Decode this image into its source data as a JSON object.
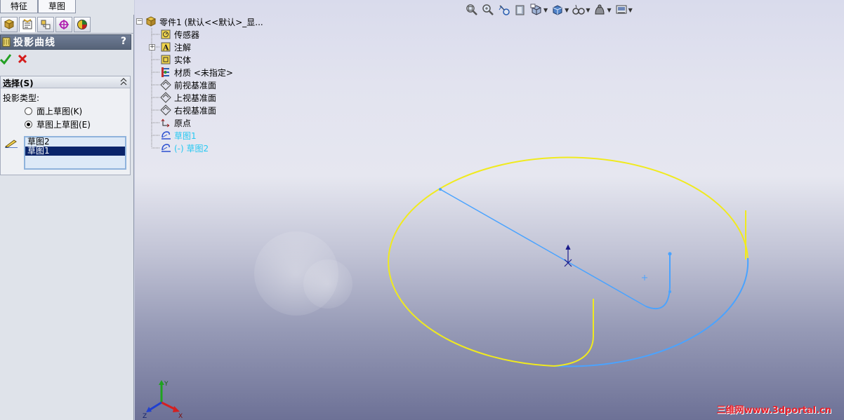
{
  "tabs": {
    "features": "特征",
    "sketch": "草图"
  },
  "property_manager": {
    "title": "投影曲线",
    "help": "?",
    "ok_icon": "check-icon",
    "cancel_icon": "x-icon",
    "selection_group": {
      "title": "选择(S)",
      "projection_type_label": "投影类型:",
      "options": [
        {
          "label": "面上草图(K)",
          "checked": false
        },
        {
          "label": "草图上草图(E)",
          "checked": true
        }
      ],
      "selected_items": [
        {
          "label": "草图2",
          "selected": false
        },
        {
          "label": "草图1",
          "selected": true
        }
      ]
    }
  },
  "feature_tree": {
    "root": "零件1   (默认<<默认>_显...",
    "items": [
      {
        "label": "传感器",
        "icon": "sensor-icon"
      },
      {
        "label": "注解",
        "icon": "annotation-icon"
      },
      {
        "label": "实体",
        "icon": "solid-body-icon"
      },
      {
        "label": "材质 <未指定>",
        "icon": "material-icon"
      },
      {
        "label": "前视基准面",
        "icon": "plane-icon"
      },
      {
        "label": "上视基准面",
        "icon": "plane-icon"
      },
      {
        "label": "右视基准面",
        "icon": "plane-icon"
      },
      {
        "label": "原点",
        "icon": "origin-icon"
      },
      {
        "label": "草图1",
        "icon": "sketch-icon"
      },
      {
        "label": "(-) 草图2",
        "icon": "sketch-icon"
      }
    ]
  },
  "watermark": "三维网www.3dportal.cn",
  "colors": {
    "highlight": "#ffff33",
    "sketch": "#4aa3ff",
    "tree_sketch": "#27c9f2",
    "watermark": "#e8202a"
  }
}
